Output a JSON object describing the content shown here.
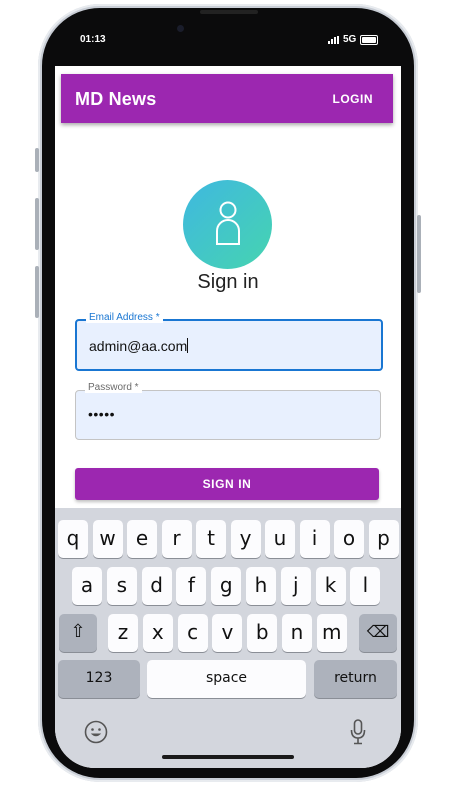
{
  "status_bar": {
    "time": "01:13",
    "network": "5G"
  },
  "app_bar": {
    "title": "MD News",
    "login_label": "LOGIN"
  },
  "signin": {
    "title": "Sign in",
    "email": {
      "label": "Email Address *",
      "value": "admin@aa.com"
    },
    "password": {
      "label": "Password *",
      "masked_value": "•••••"
    },
    "button_label": "SIGN IN"
  },
  "keyboard": {
    "row1": [
      "q",
      "w",
      "e",
      "r",
      "t",
      "y",
      "u",
      "i",
      "o",
      "p"
    ],
    "row2": [
      "a",
      "s",
      "d",
      "f",
      "g",
      "h",
      "j",
      "k",
      "l"
    ],
    "row3": [
      "z",
      "x",
      "c",
      "v",
      "b",
      "n",
      "m"
    ],
    "shift_glyph": "⇧",
    "backspace_glyph": "⌫",
    "numbers_label": "123",
    "space_label": "space",
    "return_label": "return"
  }
}
